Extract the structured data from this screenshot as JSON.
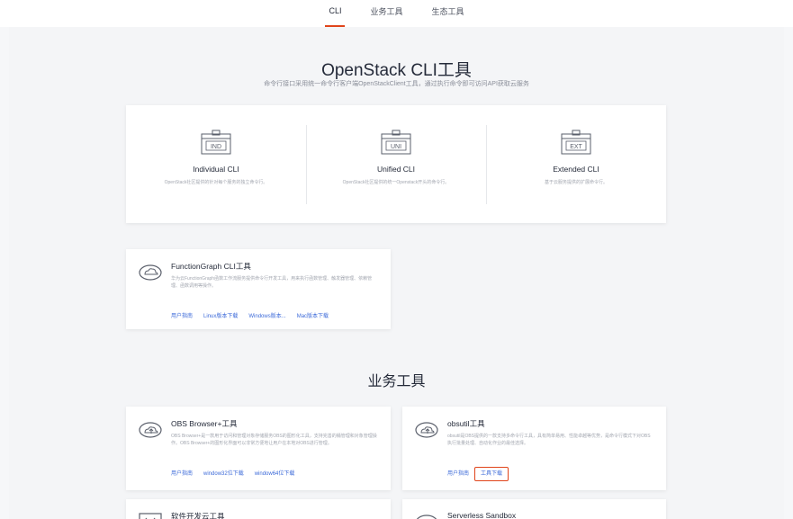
{
  "nav": {
    "tabs": [
      {
        "label": "CLI",
        "active": true
      },
      {
        "label": "业务工具",
        "active": false
      },
      {
        "label": "生态工具",
        "active": false
      }
    ]
  },
  "hero": {
    "title": "OpenStack CLI工具",
    "subtitle": "命令行接口采用统一命令行客户端OpenStackClient工具，通过执行命令即可访问API获取云服务"
  },
  "cli_types": [
    {
      "badge": "IND",
      "name": "Individual CLI",
      "desc": "OpenStack社区提供的针对每个服务的独立命令行。"
    },
    {
      "badge": "UNI",
      "name": "Unified CLI",
      "desc": "OpenStack社区提供的统一Openstack开头的命令行。"
    },
    {
      "badge": "EXT",
      "name": "Extended CLI",
      "desc": "基于云服务提供的扩展命令行。"
    }
  ],
  "functiongraph": {
    "title": "FunctionGraph CLI工具",
    "desc": "华为云FunctionGraph函数工作流服务提供命令行开发工具，用来执行函数管理、触发器管理、依赖管理、函数调用等操作。",
    "links": [
      "用户指南",
      "Linux版本下载",
      "Windows版本...",
      "Mac版本下载"
    ]
  },
  "business_section": {
    "title": "业务工具"
  },
  "obs_browser": {
    "title": "OBS Browser+工具",
    "desc": "OBS Browser+是一款用于访问和管理对象存储服务OBS的图形化工具，支持完善的桶管理和对象管理操作。OBS Browser+的图形化界面可以非常方便地让用户在本地对OBS进行管理。",
    "links": [
      "用户指南",
      "window32位下载",
      "window64位下载"
    ]
  },
  "obsutil": {
    "title": "obsutil工具",
    "desc": "obsutil是OBS提供的一款支持多命令行工具，具有简单易用、性能卓越等优势，是命令行模式下对OBS执行批量处理、自动化作业的最佳选择。",
    "links": [
      "用户指南",
      "工具下载"
    ]
  },
  "devcloud": {
    "title": "软件开发云工具"
  },
  "serverless": {
    "title": "Serverless Sandbox"
  },
  "colors": {
    "accent": "#e0441a",
    "link": "#3c6ad9"
  }
}
